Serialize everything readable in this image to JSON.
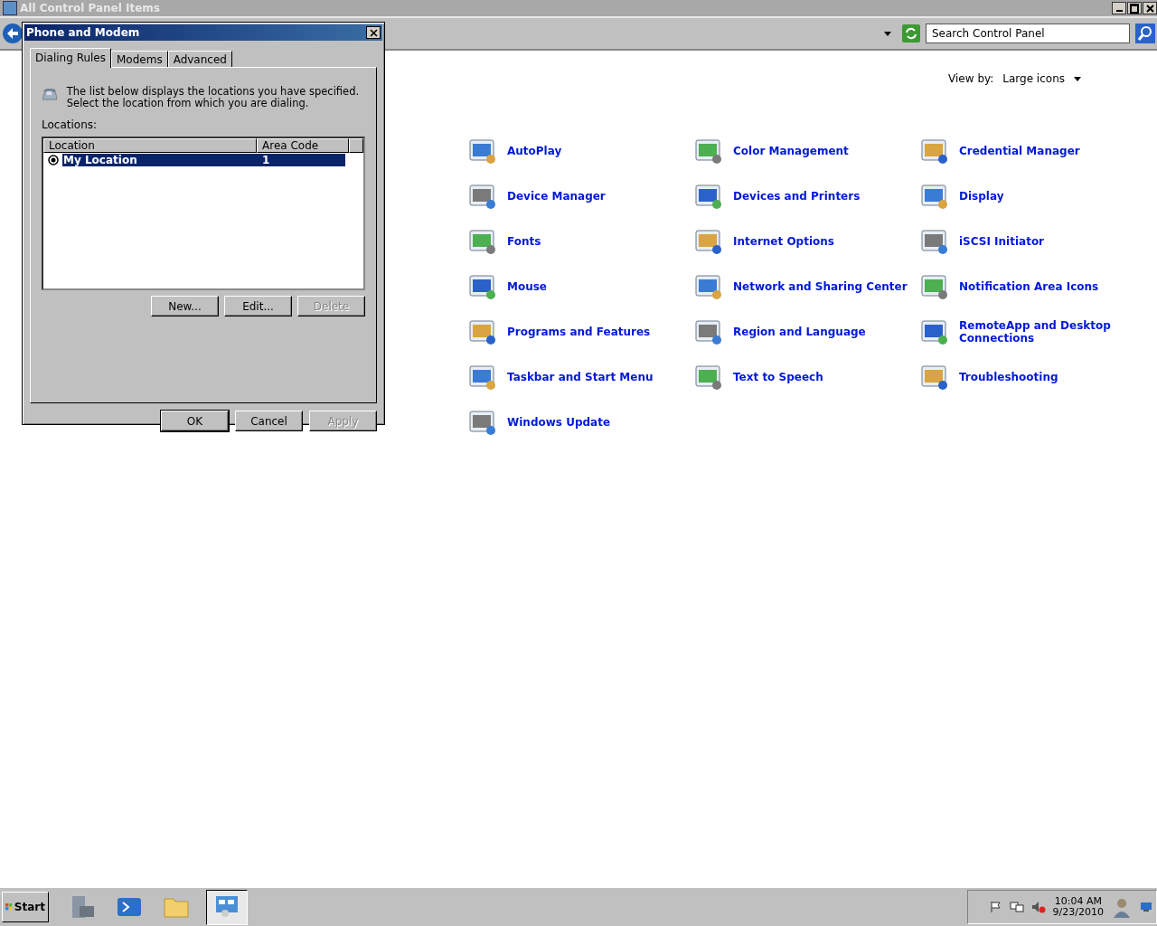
{
  "window": {
    "title": "All Control Panel Items"
  },
  "search": {
    "placeholder": "Search Control Panel"
  },
  "view_by": {
    "label": "View by:",
    "value": "Large icons"
  },
  "items": [
    {
      "label": "AutoPlay"
    },
    {
      "label": "Color Management"
    },
    {
      "label": "Credential Manager"
    },
    {
      "label": "Device Manager"
    },
    {
      "label": "Devices and Printers"
    },
    {
      "label": "Display"
    },
    {
      "label": "Fonts"
    },
    {
      "label": "Internet Options"
    },
    {
      "label": "iSCSI Initiator"
    },
    {
      "label": "Mouse"
    },
    {
      "label": "Network and Sharing Center"
    },
    {
      "label": "Notification Area Icons"
    },
    {
      "label": "Programs and Features"
    },
    {
      "label": "Region and Language"
    },
    {
      "label": "RemoteApp and Desktop Connections"
    },
    {
      "label": "Taskbar and Start Menu"
    },
    {
      "label": "Text to Speech"
    },
    {
      "label": "Troubleshooting"
    },
    {
      "label": "Windows Update"
    }
  ],
  "dialog": {
    "title": "Phone and Modem",
    "tabs": [
      {
        "label": "Dialing Rules",
        "selected": true
      },
      {
        "label": "Modems",
        "selected": false
      },
      {
        "label": "Advanced",
        "selected": false
      }
    ],
    "description": "The list below displays the locations you have specified. Select the location from which you are dialing.",
    "locations_label": "Locations:",
    "columns": [
      "Location",
      "Area Code"
    ],
    "rows": [
      {
        "location": "My Location",
        "area_code": "1",
        "selected": true
      }
    ],
    "list_buttons": [
      {
        "label": "New...",
        "disabled": false
      },
      {
        "label": "Edit...",
        "disabled": false
      },
      {
        "label": "Delete",
        "disabled": true
      }
    ],
    "footer_buttons": [
      {
        "label": "OK",
        "disabled": false
      },
      {
        "label": "Cancel",
        "disabled": false
      },
      {
        "label": "Apply",
        "disabled": true
      }
    ]
  },
  "taskbar": {
    "start": "Start",
    "time": "10:04 AM",
    "date": "9/23/2010"
  }
}
